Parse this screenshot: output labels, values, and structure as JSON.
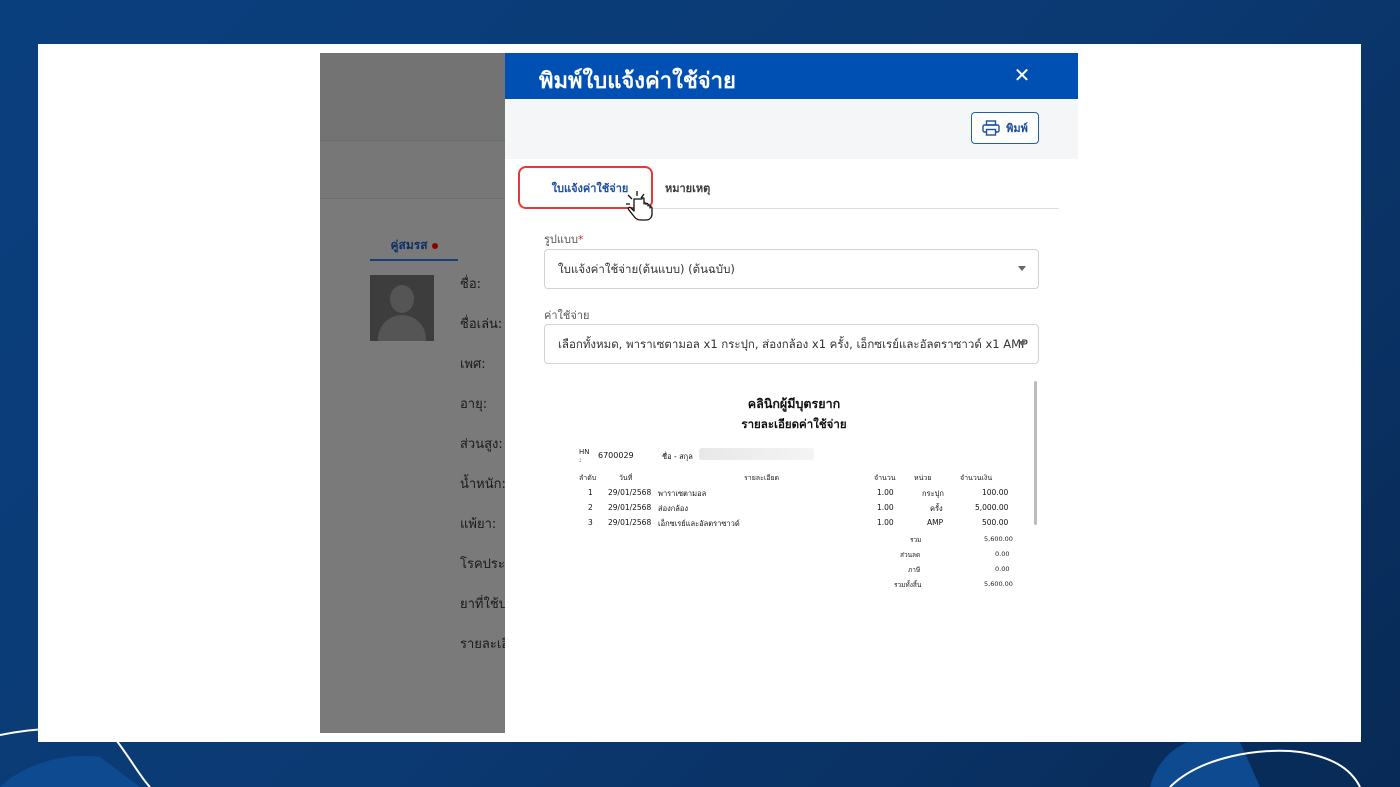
{
  "background_app": {
    "tab_label": "คู่สมรส",
    "fields": [
      "ชื่อ:",
      "ชื่อเล่น:",
      "เพศ:",
      "อายุ:",
      "ส่วนสูง:",
      "น้ำหนัก:",
      "แพ้ยา:",
      "โรคประจ",
      "ยาที่ใช้ป",
      "รายละเอี"
    ]
  },
  "modal": {
    "title": "พิมพ์ใบแจ้งค่าใช้จ่าย",
    "close_icon": "close-icon",
    "print_label": "พิมพ์",
    "tabs": [
      {
        "label": "ใบแจ้งค่าใช้จ่าย",
        "active": true
      },
      {
        "label": "หมายเหตุ",
        "active": false
      }
    ],
    "format": {
      "label": "รูปแบบ",
      "required_mark": "*",
      "value": "ใบแจ้งค่าใช้จ่าย(ต้นแบบ) (ต้นฉบับ)"
    },
    "expense": {
      "label": "ค่าใช้จ่าย",
      "value": "เลือกทั้งหมด, พาราเซตามอล x1 กระปุก, ส่องกล้อง x1 ครั้ง, เอ็กซเรย์และอัลตราซาวด์ x1 AMP"
    }
  },
  "preview": {
    "clinic_name": "คลินิกผู้มีบุตรยาก",
    "doc_title": "รายละเอียดค่าใช้จ่าย",
    "hn_label": "HN",
    "hn_colon": ":",
    "hn_value": "6700029",
    "name_label": "ชื่อ - สกุล",
    "columns": {
      "no": "ลำดับ",
      "date": "วันที่",
      "detail": "รายละเอียด",
      "qty": "จำนวน",
      "unit": "หน่วย",
      "amount": "จำนวนเงิน"
    },
    "rows": [
      {
        "no": "1",
        "date": "29/01/2568",
        "detail": "พาราเซตามอล",
        "qty": "1.00",
        "unit": "กระปุก",
        "amount": "100.00"
      },
      {
        "no": "2",
        "date": "29/01/2568",
        "detail": "ส่องกล้อง",
        "qty": "1.00",
        "unit": "ครั้ง",
        "amount": "5,000.00"
      },
      {
        "no": "3",
        "date": "29/01/2568",
        "detail": "เอ็กซเรย์และอัลตราซาวด์",
        "qty": "1.00",
        "unit": "AMP",
        "amount": "500.00"
      }
    ],
    "summary": [
      {
        "label": "รวม",
        "value": "5,600.00"
      },
      {
        "label": "ส่วนลด",
        "value": "0.00"
      },
      {
        "label": "ภาษี",
        "value": "0.00"
      },
      {
        "label": "รวมทั้งสิ้น",
        "value": "5,600.00"
      }
    ]
  },
  "colors": {
    "primary": "#0050b4",
    "highlight": "#e53935",
    "background": "#0b3a73"
  }
}
